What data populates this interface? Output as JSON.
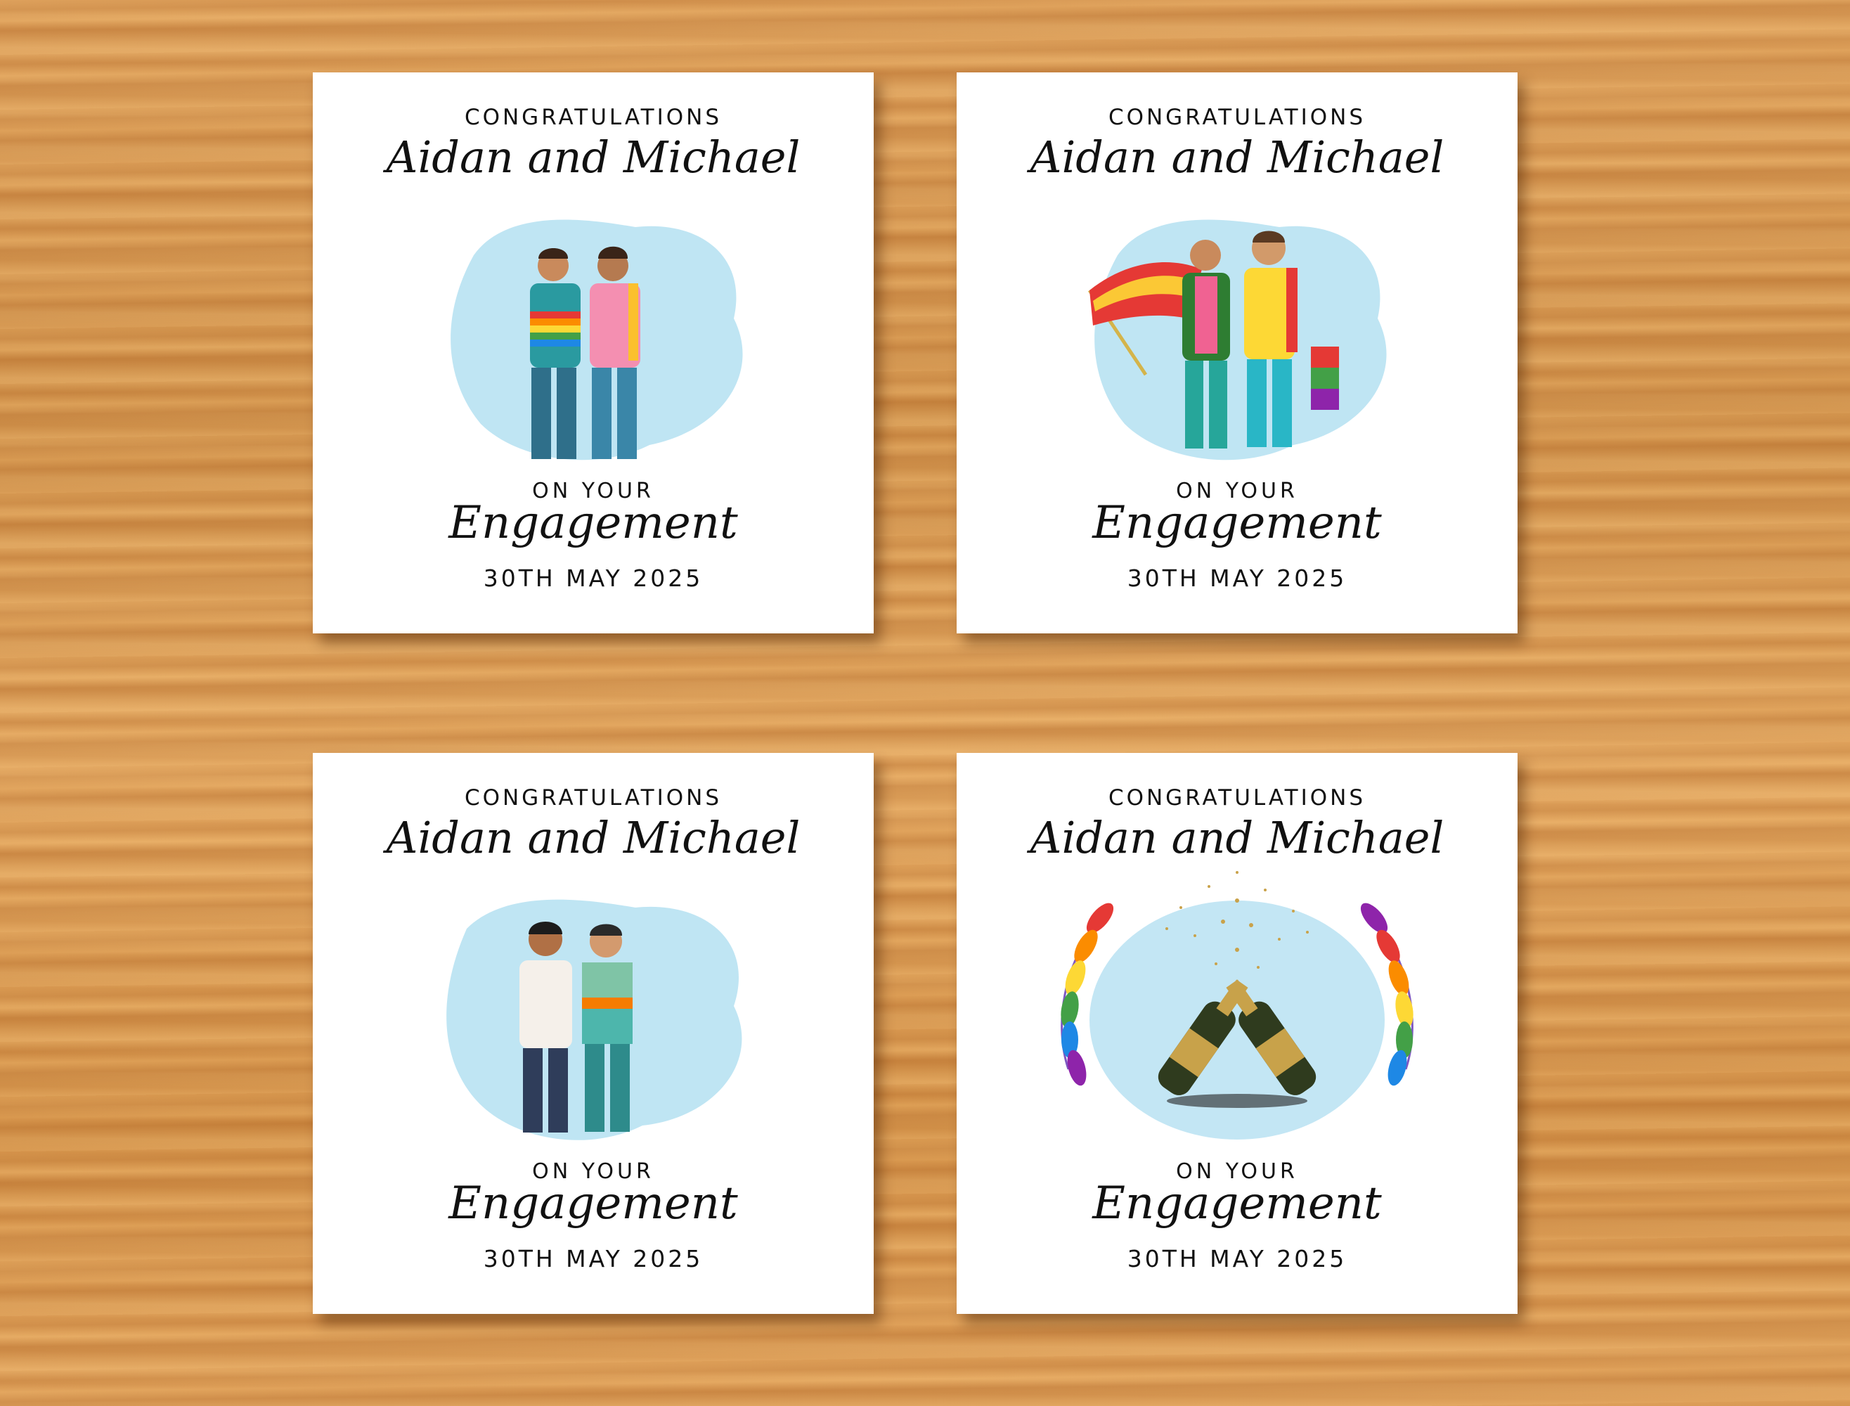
{
  "cards": [
    {
      "congratulations": "CONGRATULATIONS",
      "names": "Aidan and Michael",
      "on_your": "ON YOUR",
      "engagement": "Engagement",
      "date": "30TH MAY 2025"
    },
    {
      "congratulations": "CONGRATULATIONS",
      "names": "Aidan and Michael",
      "on_your": "ON YOUR",
      "engagement": "Engagement",
      "date": "30TH MAY 2025"
    },
    {
      "congratulations": "CONGRATULATIONS",
      "names": "Aidan and Michael",
      "on_your": "ON YOUR",
      "engagement": "Engagement",
      "date": "30TH MAY 2025"
    },
    {
      "congratulations": "CONGRATULATIONS",
      "names": "Aidan and Michael",
      "on_your": "ON YOUR",
      "engagement": "Engagement",
      "date": "30TH MAY 2025"
    }
  ],
  "colors": {
    "wash": "#a9dcef",
    "wood": "#dca05a"
  }
}
